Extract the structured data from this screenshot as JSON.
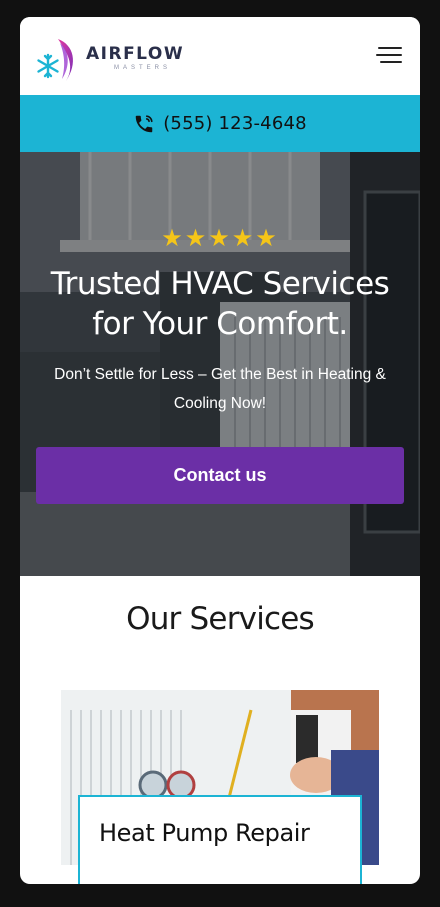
{
  "brand": {
    "name": "AIRFLOW",
    "subtitle": "MASTERS"
  },
  "menu": {
    "icon": "hamburger-menu-icon"
  },
  "phone_bar": {
    "icon": "phone-icon",
    "number": "(555) 123-4648",
    "color": "#1cb4d4"
  },
  "hero": {
    "rating": "★★★★★",
    "title": "Trusted HVAC Services for Your Comfort.",
    "subtitle": "Don’t Settle for Less – Get the Best in Heating & Cooling Now!",
    "cta_label": "Contact us",
    "cta_color": "#6b2fa6"
  },
  "services": {
    "heading": "Our Services",
    "items": [
      {
        "title": "Heat Pump Repair"
      }
    ]
  }
}
